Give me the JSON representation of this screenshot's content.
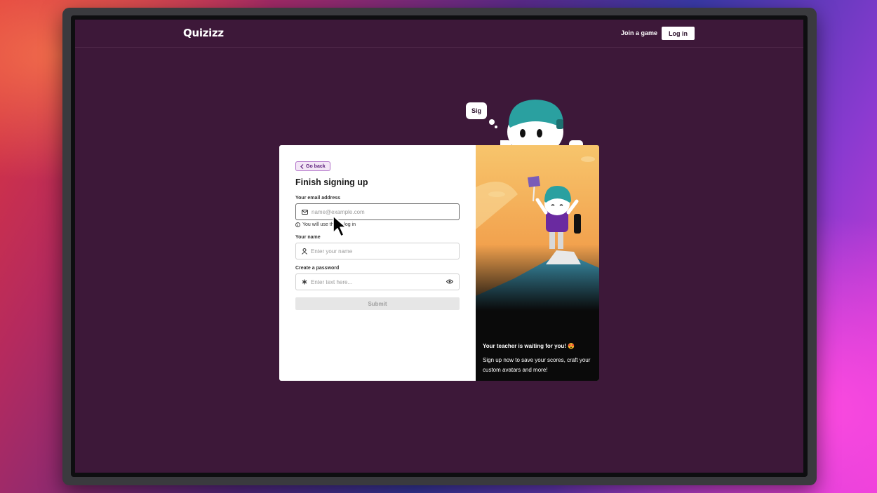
{
  "nav": {
    "logo": "Quizizz",
    "join_label": "Join a game",
    "login_label": "Log in"
  },
  "mascot": {
    "speech": "Sig"
  },
  "form": {
    "back_label": "Go back",
    "title": "Finish signing up",
    "email": {
      "label": "Your email address",
      "placeholder": "name@example.com",
      "icon": "mail-icon",
      "hint": "You will use this to log in"
    },
    "name": {
      "label": "Your name",
      "placeholder": "Enter your name",
      "icon": "user-icon"
    },
    "password": {
      "label": "Create a password",
      "placeholder": "Enter text here...",
      "icon": "asterisk-icon",
      "toggle_icon": "eye-icon"
    },
    "submit_label": "Submit"
  },
  "promo": {
    "heading": "Your teacher is waiting for you!",
    "emoji": "😍",
    "body": "Sign up now to save your scores, craft your custom avatars and more!"
  },
  "colors": {
    "screen_bg": "#3d1839",
    "accent_purple": "#5b1d7a",
    "mascot_teal": "#2aa0a0",
    "art_orange": "#f5b85a"
  }
}
